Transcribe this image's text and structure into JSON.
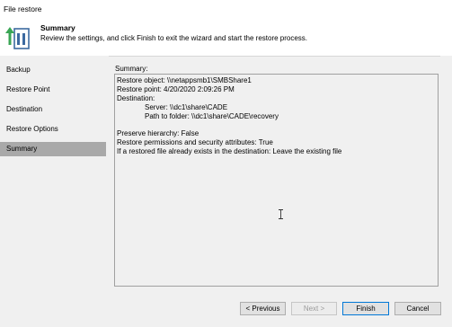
{
  "window": {
    "title": "File restore"
  },
  "header": {
    "title": "Summary",
    "description": "Review the settings, and click Finish to exit the wizard and start the restore process."
  },
  "sidebar": {
    "items": [
      {
        "label": "Backup"
      },
      {
        "label": "Restore Point"
      },
      {
        "label": "Destination"
      },
      {
        "label": "Restore Options"
      },
      {
        "label": "Summary",
        "active": true
      }
    ]
  },
  "summary": {
    "label": "Summary:",
    "lines": [
      "Restore object: \\\\netappsmb1\\SMBShare1",
      "Restore point: 4/20/2020 2:09:26 PM",
      "Destination:",
      "Server: \\\\dc1\\share\\CADE",
      "Path to folder: \\\\dc1\\share\\CADE\\recovery",
      "Preserve hierarchy: False",
      "Restore permissions and security attributes: True",
      "If a restored file already exists in the destination: Leave the existing file"
    ]
  },
  "buttons": {
    "previous": "< Previous",
    "next": "Next >",
    "finish": "Finish",
    "cancel": "Cancel"
  },
  "colors": {
    "active_item_bg": "#a9a9a9",
    "primary_border": "#0078d7",
    "icon_arrow": "#3aa655"
  },
  "icons": {
    "wizard": "restore-wizard-icon",
    "cursor": "text-cursor-icon"
  }
}
